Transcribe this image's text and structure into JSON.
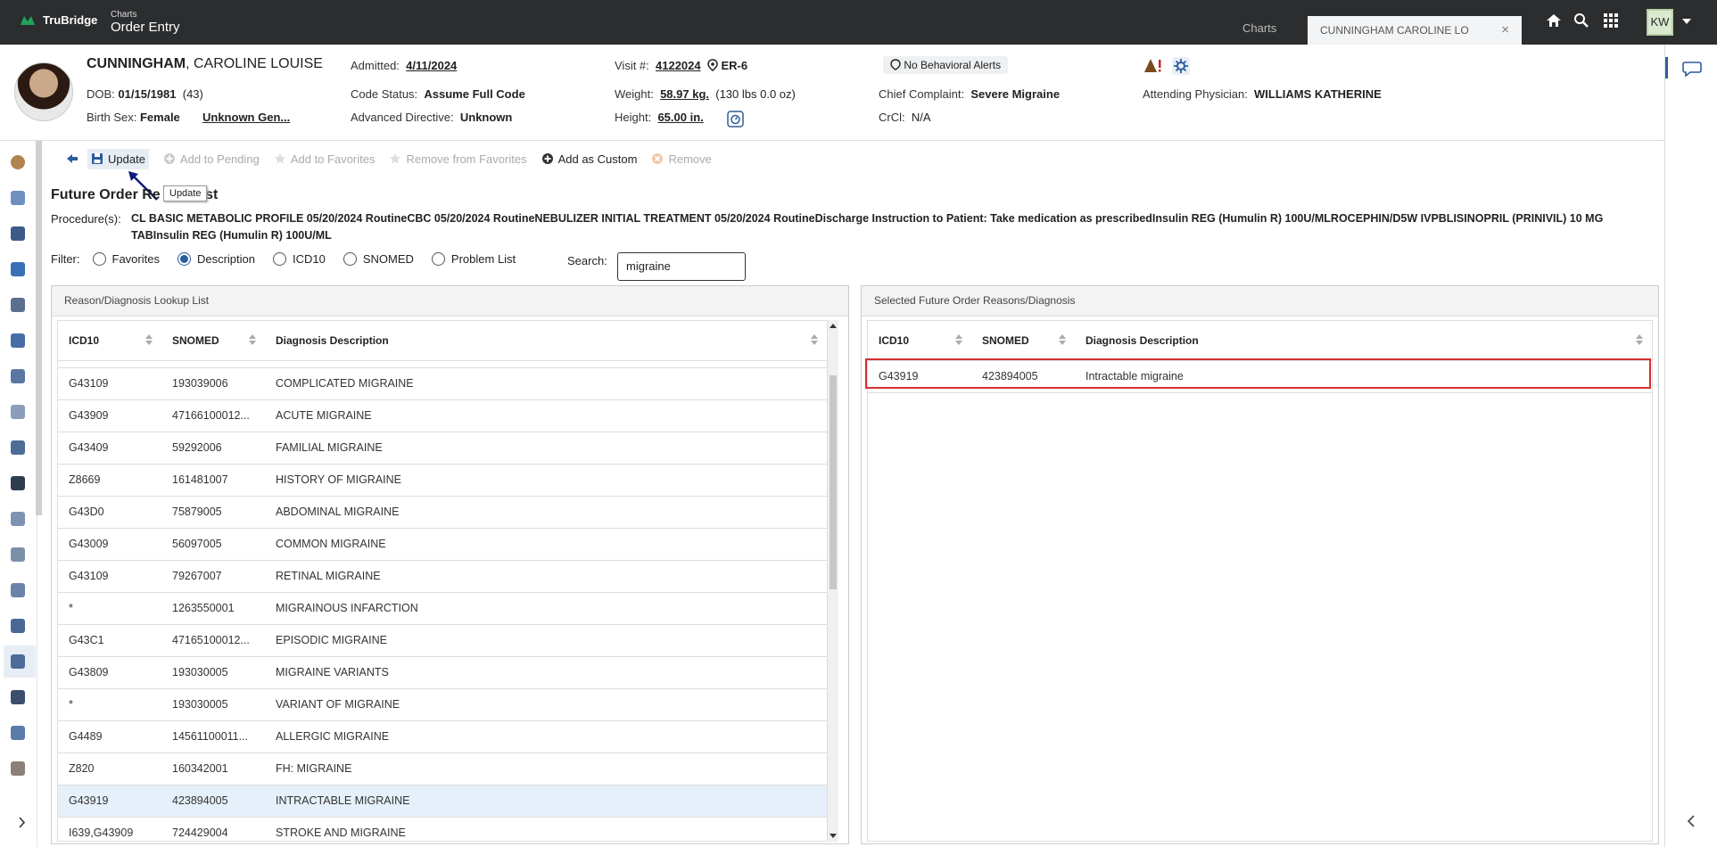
{
  "topbar": {
    "brand": "TruBridge",
    "module_small": "Charts",
    "module": "Order Entry",
    "charts_tab": "Charts",
    "patient_tab": "CUNNINGHAM CAROLINE LO",
    "user_initials": "KW"
  },
  "patient": {
    "last_name": "CUNNINGHAM",
    "first_name": ", CAROLINE LOUISE",
    "dob_label": "DOB:",
    "dob": "01/15/1981",
    "age": "(43)",
    "sex_label": "Birth Sex:",
    "sex": "Female",
    "gender": "Unknown Gen...",
    "admitted_label": "Admitted:",
    "admitted": "4/11/2024",
    "code_label": "Code Status:",
    "code": "Assume Full Code",
    "advdir_label": "Advanced Directive:",
    "advdir": "Unknown",
    "visit_label": "Visit #:",
    "visit": "4122024",
    "location": "ER-6",
    "weight_label": "Weight:",
    "weight": "58.97 kg.",
    "weight_alt": "(130 lbs 0.0 oz)",
    "height_label": "Height:",
    "height": "65.00 in.",
    "behavioral": "No Behavioral Alerts",
    "complaint_label": "Chief Complaint:",
    "complaint": "Severe Migraine",
    "crcl_label": "CrCl:",
    "crcl": "N/A",
    "physician_label": "Attending Physician:",
    "physician": "WILLIAMS KATHERINE"
  },
  "toolbar": {
    "update": "Update",
    "add_pending": "Add to Pending",
    "add_fav": "Add to Favorites",
    "remove_fav": "Remove from Favorites",
    "add_custom": "Add as Custom",
    "remove": "Remove",
    "tooltip": "Update"
  },
  "section": {
    "title_a": "Future Order Re",
    "title_b": "ist",
    "proc_label": "Procedure(s):",
    "procedures": "CL BASIC METABOLIC PROFILE 05/20/2024 RoutineCBC 05/20/2024 RoutineNEBULIZER INITIAL TREATMENT 05/20/2024 RoutineDischarge Instruction to Patient: Take medication as prescribedInsulin REG (Humulin R) 100U/MLROCEPHIN/D5W IVPBLISINOPRIL (PRINIVIL) 10 MG TABInsulin REG (Humulin R) 100U/ML"
  },
  "filter": {
    "label": "Filter:",
    "options": [
      "Favorites",
      "Description",
      "ICD10",
      "SNOMED",
      "Problem List"
    ],
    "selected": "Description",
    "search_label": "Search:",
    "search_value": "migraine"
  },
  "lookup": {
    "title": "Reason/Diagnosis Lookup List",
    "columns": [
      "ICD10",
      "SNOMED",
      "Diagnosis Description"
    ],
    "rows": [
      [
        "G43109",
        "193039006",
        "COMPLICATED MIGRAINE"
      ],
      [
        "G43909",
        "47166100012...",
        "ACUTE MIGRAINE"
      ],
      [
        "G43409",
        "59292006",
        "FAMILIAL MIGRAINE"
      ],
      [
        "Z8669",
        "161481007",
        "HISTORY OF MIGRAINE"
      ],
      [
        "G43D0",
        "75879005",
        "ABDOMINAL MIGRAINE"
      ],
      [
        "G43009",
        "56097005",
        "COMMON MIGRAINE"
      ],
      [
        "G43109",
        "79267007",
        "RETINAL MIGRAINE"
      ],
      [
        "*",
        "1263550001",
        "MIGRAINOUS INFARCTION"
      ],
      [
        "G43C1",
        "47165100012...",
        "EPISODIC MIGRAINE"
      ],
      [
        "G43809",
        "193030005",
        "MIGRAINE VARIANTS"
      ],
      [
        "*",
        "193030005",
        "VARIANT OF MIGRAINE"
      ],
      [
        "G4489",
        "14561100011...",
        "ALLERGIC MIGRAINE"
      ],
      [
        "Z820",
        "160342001",
        "FH: MIGRAINE"
      ],
      [
        "G43919",
        "423894005",
        "INTRACTABLE MIGRAINE"
      ],
      [
        "I639,G43909",
        "724429004",
        "STROKE AND MIGRAINE"
      ]
    ],
    "selected_row": 13
  },
  "selected": {
    "title": "Selected Future Order Reasons/Diagnosis",
    "columns": [
      "ICD10",
      "SNOMED",
      "Diagnosis Description"
    ],
    "rows": [
      [
        "G43919",
        "423894005",
        "Intractable migraine"
      ]
    ]
  },
  "colors": {
    "accent": "#2c5d9c",
    "topbar": "#2b2d2f",
    "highlight": "#d32f2f",
    "brand_green": "#1fa35b"
  }
}
